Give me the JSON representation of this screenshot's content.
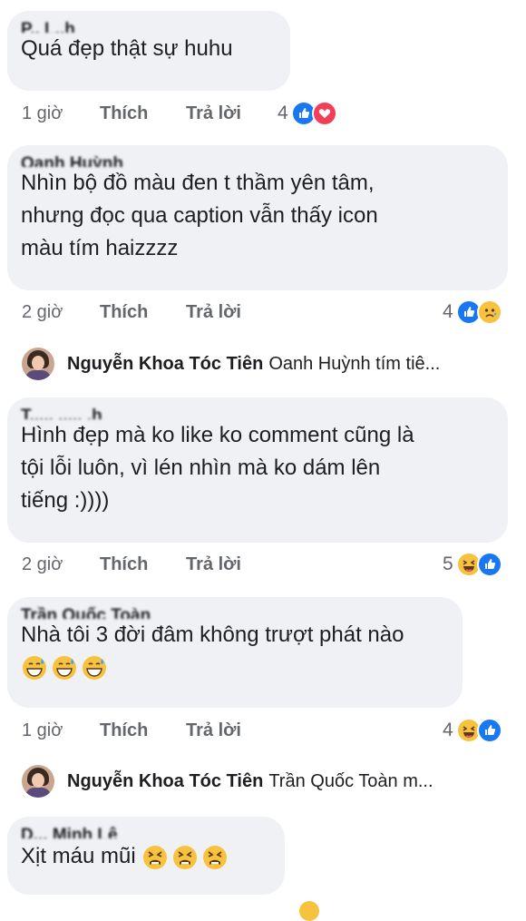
{
  "comments": [
    {
      "author": "P.. L..h",
      "text": "Quá đẹp thật sự huhu",
      "time": "1 giờ",
      "like": "Thích",
      "reply": "Trả lời",
      "reaction_count": "4",
      "reactions": [
        "like-icon",
        "heart-icon"
      ]
    },
    {
      "author": "Oanh Huỳnh",
      "text": "Nhìn bộ đồ màu đen t thầm yên tâm,\nnhưng đọc qua caption vẫn thấy icon\nmàu tím haizzzz",
      "time": "2 giờ",
      "like": "Thích",
      "reply": "Trả lời",
      "reaction_count": "4",
      "reactions": [
        "like-icon",
        "sad-icon"
      ]
    },
    {
      "author": "T..... ..... .h",
      "text": "Hình đẹp mà ko like ko comment cũng là\ntội lỗi luôn, vì lén nhìn mà ko dám lên\ntiếng :))))",
      "time": "2 giờ",
      "like": "Thích",
      "reply": "Trả lời",
      "reaction_count": "5",
      "reactions": [
        "haha-icon",
        "like-icon"
      ]
    },
    {
      "author": "Trần Quốc Toàn",
      "text": "Nhà tôi 3 đời đâm không trượt phát nào",
      "time": "1 giờ",
      "like": "Thích",
      "reply": "Trả lời",
      "reaction_count": "4",
      "reactions": [
        "haha-icon",
        "like-icon"
      ]
    },
    {
      "author": "D... Minh Lê",
      "text": "Xịt máu mũi"
    }
  ],
  "replies": [
    {
      "name": "Nguyễn Khoa Tóc Tiên",
      "text": "Oanh Huỳnh  tím tiê..."
    },
    {
      "name": "Nguyễn Khoa Tóc Tiên",
      "text": "Trần Quốc Toàn  m..."
    }
  ],
  "colors": {
    "bubble": "#eff1f4",
    "meta_text": "#63666b",
    "like_blue": "#1877f2",
    "heart_red": "#f33e58",
    "emoji_yellow": "#f7c23d"
  }
}
